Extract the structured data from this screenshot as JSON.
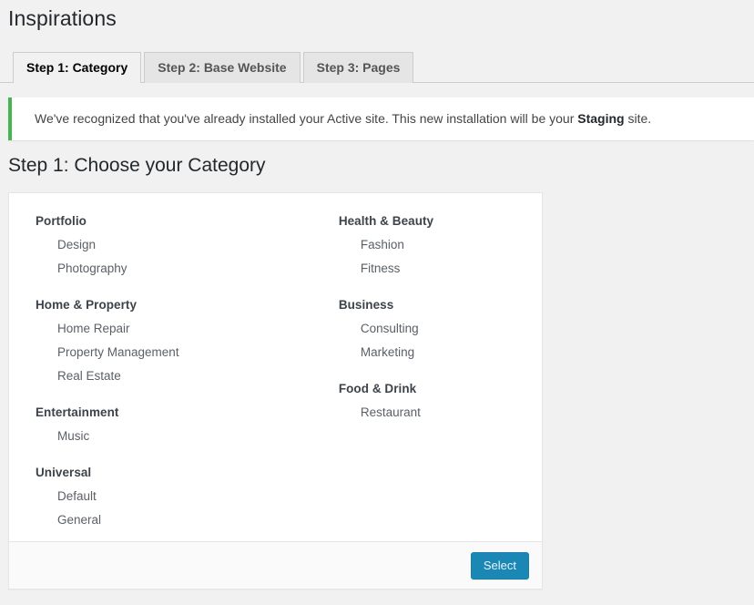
{
  "page": {
    "title": "Inspirations"
  },
  "tabs": [
    {
      "label": "Step 1: Category",
      "active": true
    },
    {
      "label": "Step 2: Base Website",
      "active": false
    },
    {
      "label": "Step 3: Pages",
      "active": false
    }
  ],
  "notice": {
    "text_before": "We've recognized that you've already installed your Active site. This new installation will be your ",
    "emphasis": "Staging",
    "text_after": " site.",
    "accent_color": "#46b450"
  },
  "section": {
    "heading": "Step 1: Choose your Category"
  },
  "categories": {
    "left_column": [
      {
        "group": "Portfolio",
        "items": [
          "Design",
          "Photography"
        ]
      },
      {
        "group": "Home & Property",
        "items": [
          "Home Repair",
          "Property Management",
          "Real Estate"
        ]
      },
      {
        "group": "Entertainment",
        "items": [
          "Music"
        ]
      },
      {
        "group": "Universal",
        "items": [
          "Default",
          "General"
        ]
      }
    ],
    "right_column": [
      {
        "group": "Health & Beauty",
        "items": [
          "Fashion",
          "Fitness"
        ]
      },
      {
        "group": "Business",
        "items": [
          "Consulting",
          "Marketing"
        ]
      },
      {
        "group": "Food & Drink",
        "items": [
          "Restaurant"
        ]
      }
    ]
  },
  "footer": {
    "select_label": "Select",
    "button_color": "#1b87b4"
  }
}
